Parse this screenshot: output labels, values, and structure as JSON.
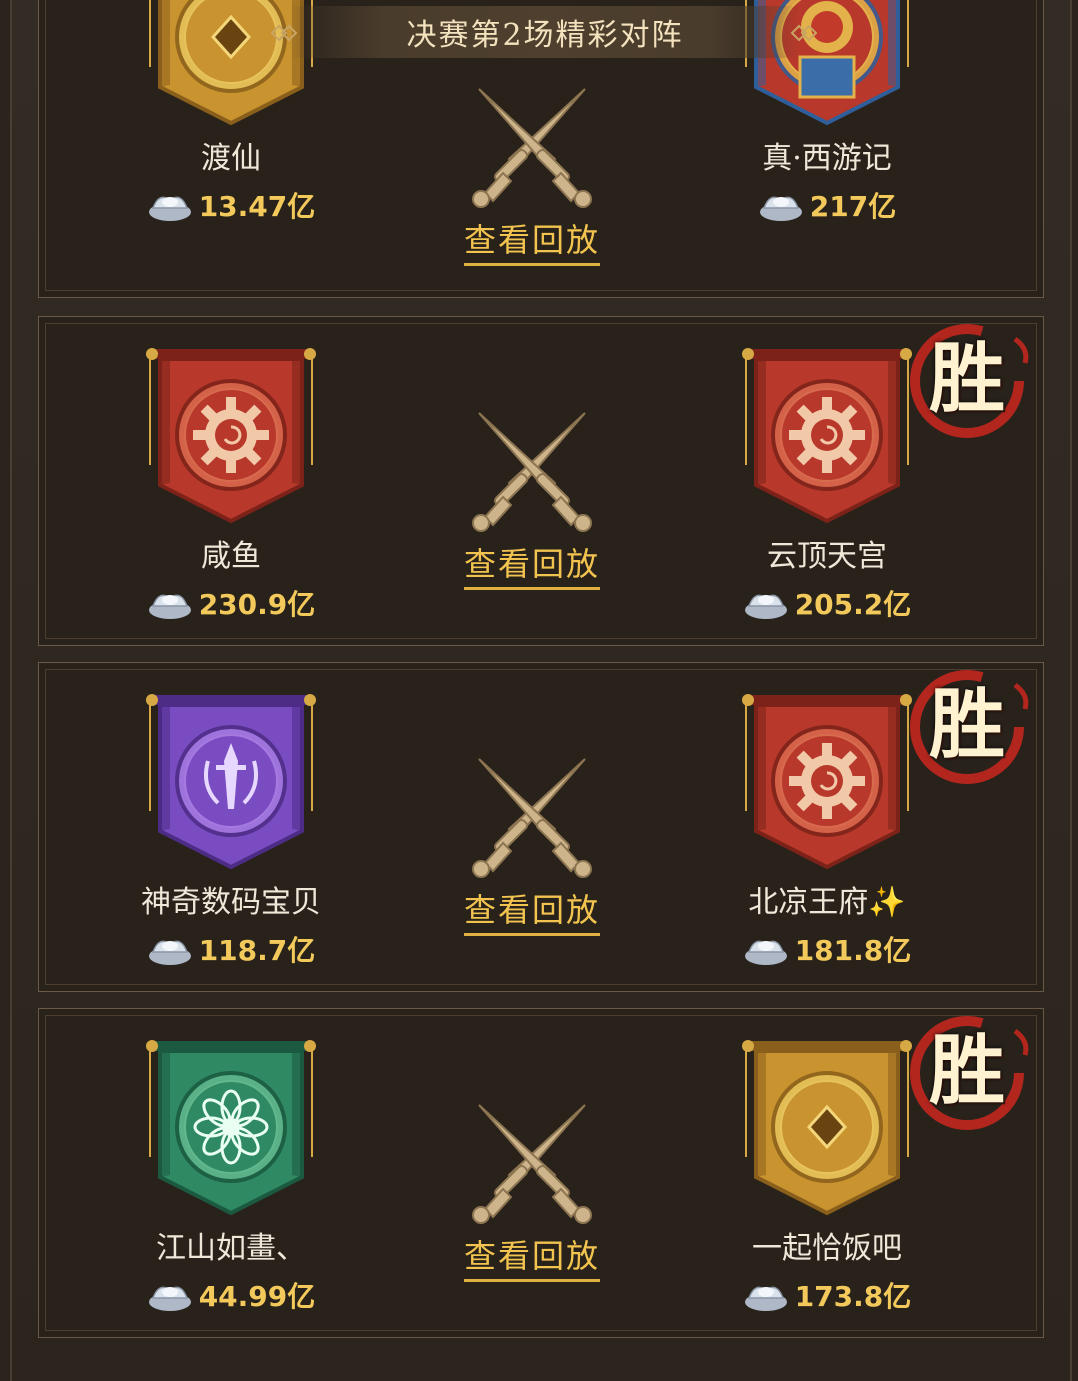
{
  "header": {
    "title": "决赛第2场精彩对阵"
  },
  "colors": {
    "gold": "#f2c95a",
    "cream": "#efe7d8",
    "win_red": "#b3261e",
    "panel": "#2e2820"
  },
  "matches": [
    {
      "left": {
        "name": "渡仙",
        "power": "13.47亿",
        "banner": "gold-diamond"
      },
      "right": {
        "name": "真·西游记",
        "power": "217亿",
        "banner": "blue-red-ornate",
        "win": false
      },
      "replay": "查看回放"
    },
    {
      "left": {
        "name": "咸鱼",
        "power": "230.9亿",
        "banner": "red-gear"
      },
      "right": {
        "name": "云顶天宫",
        "power": "205.2亿",
        "banner": "red-gear",
        "win": true
      },
      "replay": "查看回放"
    },
    {
      "left": {
        "name": "神奇数码宝贝",
        "power": "118.7亿",
        "banner": "purple-sword"
      },
      "right": {
        "name": "北凉王府✨",
        "power": "181.8亿",
        "banner": "red-gear",
        "win": true
      },
      "replay": "查看回放"
    },
    {
      "left": {
        "name": "江山如畫、",
        "power": "44.99亿",
        "banner": "green-flower"
      },
      "right": {
        "name": "一起恰饭吧",
        "power": "173.8亿",
        "banner": "gold-diamond",
        "win": true
      },
      "replay": "查看回放"
    }
  ],
  "win_label": "胜",
  "icons": {
    "currency": "silver-ingot-icon",
    "vs": "crossed-swords-icon"
  }
}
